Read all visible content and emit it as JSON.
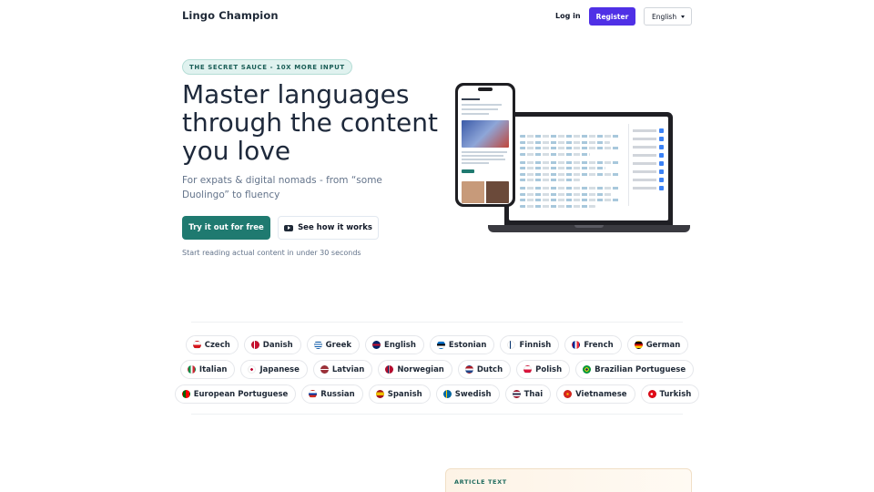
{
  "header": {
    "brand": "Lingo Champion",
    "login": "Log in",
    "register": "Register",
    "language": "English"
  },
  "hero": {
    "badge": "THE SECRET SAUCE - 10X MORE INPUT",
    "title": "Master languages through the content you love",
    "subtitle": "For expats & digital nomads - from “some Duolingo” to fluency",
    "cta_primary": "Try it out for free",
    "cta_secondary": "See how it works",
    "tagline": "Start reading actual content in under 30 seconds"
  },
  "languages": {
    "rows": [
      [
        {
          "name": "Czech",
          "flag": "linear-gradient(180deg,#ffffff 0 50%,#d7141a 50%)"
        },
        {
          "name": "Danish",
          "flag": "linear-gradient(90deg,#c8102e 0 30%,#fff 30% 45%,#c8102e 45%)"
        },
        {
          "name": "Greek",
          "flag": "repeating-linear-gradient(180deg,#0d5eaf 0 1.2px,#fff 1.2px 2.4px)"
        },
        {
          "name": "English",
          "flag": "linear-gradient(180deg,#012169 0 35%,#c8102e 35% 65%,#012169 65%)"
        },
        {
          "name": "Estonian",
          "flag": "linear-gradient(180deg,#0072ce 0 33%,#000 33% 66%,#fff 66%)"
        },
        {
          "name": "Finnish",
          "flag": "linear-gradient(90deg,#fff 0 30%,#002f6c 30% 45%,#fff 45%)"
        },
        {
          "name": "French",
          "flag": "linear-gradient(90deg,#002395 0 33%,#fff 33% 66%,#ed2939 66%)"
        },
        {
          "name": "German",
          "flag": "linear-gradient(180deg,#000 0 33%,#dd0000 33% 66%,#ffce00 66%)"
        }
      ],
      [
        {
          "name": "Italian",
          "flag": "linear-gradient(90deg,#009246 0 33%,#fff 33% 66%,#ce2b37 66%)"
        },
        {
          "name": "Japanese",
          "flag": "radial-gradient(circle,#bc002d 0 28%,#fff 30%)"
        },
        {
          "name": "Latvian",
          "flag": "linear-gradient(180deg,#9e3039 0 40%,#fff 40% 60%,#9e3039 60%)"
        },
        {
          "name": "Norwegian",
          "flag": "linear-gradient(90deg,#ba0c2f 0 28%,#fff 28% 32%,#00205b 32% 46%,#fff 46% 50%,#ba0c2f 50%)"
        },
        {
          "name": "Dutch",
          "flag": "linear-gradient(180deg,#ae1c28 0 33%,#fff 33% 66%,#21468b 66%)"
        },
        {
          "name": "Polish",
          "flag": "linear-gradient(180deg,#fff 0 50%,#dc143c 50%)"
        },
        {
          "name": "Brazilian Portuguese",
          "flag": "radial-gradient(circle,#002776 0 25%,#ffdf00 27% 45%,#009c3b 47%)"
        }
      ],
      [
        {
          "name": "European Portuguese",
          "flag": "linear-gradient(90deg,#006600 0 40%,#ff0000 40%)"
        },
        {
          "name": "Russian",
          "flag": "linear-gradient(180deg,#fff 0 33%,#0039a6 33% 66%,#d52b1e 66%)"
        },
        {
          "name": "Spanish",
          "flag": "linear-gradient(180deg,#aa151b 0 25%,#f1bf00 25% 75%,#aa151b 75%)"
        },
        {
          "name": "Swedish",
          "flag": "linear-gradient(90deg,#006aa7 0 30%,#fecc00 30% 45%,#006aa7 45%)"
        },
        {
          "name": "Thai",
          "flag": "linear-gradient(180deg,#a51931 0 16%,#fff 16% 33%,#2d2a4a 33% 66%,#fff 66% 83%,#a51931 83%)"
        },
        {
          "name": "Vietnamese",
          "flag": "radial-gradient(circle,#ffcd00 0 22%,#da251d 24%)"
        },
        {
          "name": "Turkish",
          "flag": "radial-gradient(circle at 40% 50%,#fff 0 22%,#e30a17 24%)"
        }
      ]
    ]
  },
  "article": {
    "label": "ARTICLE TEXT"
  },
  "colors": {
    "brand_purple": "#4f30e6",
    "primary_teal": "#1f7a70"
  }
}
